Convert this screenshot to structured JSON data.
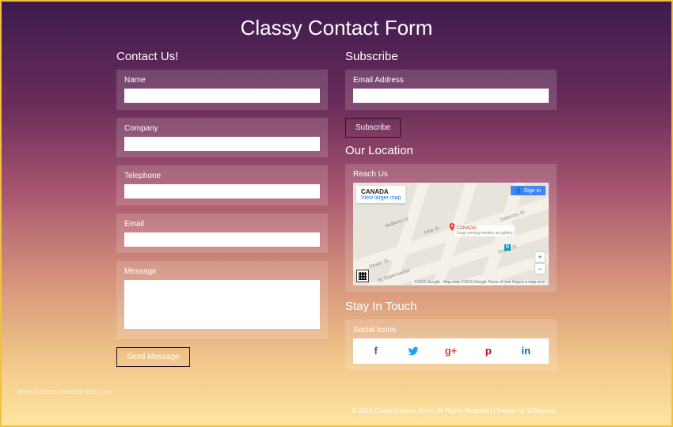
{
  "title": "Classy Contact Form",
  "contact": {
    "heading": "Contact Us!",
    "fields": {
      "name": "Name",
      "company": "Company",
      "telephone": "Telephone",
      "email": "Email",
      "message": "Message"
    },
    "submit": "Send Message"
  },
  "subscribe": {
    "heading": "Subscribe",
    "email_label": "Email Address",
    "button": "Subscribe"
  },
  "location": {
    "heading": "Our Location",
    "label": "Reach Us",
    "map": {
      "country": "CANADA",
      "view_larger": "View larger map",
      "signin": "Sign in",
      "marker_title": "CANADA",
      "marker_sub": "Long-running modern art gallery",
      "streets": [
        "Mulberry St",
        "Mott St",
        "Delancey St",
        "Grand St",
        "Hester St"
      ],
      "supermarket": "ng Supermarket",
      "metro": "M",
      "attribution": "©2016 Google - Map data ©2016 Google   Terms of Use   Report a map error"
    }
  },
  "stay": {
    "heading": "Stay In Touch",
    "label": "Social Icons",
    "icons": {
      "facebook": "f",
      "twitter": "twitter",
      "googleplus": "g+",
      "pinterest": "p",
      "linkedin": "in"
    }
  },
  "footer": "© 2016 Classy Contact Form. All Rights Reserved | Design by W3layouts",
  "watermark": "www.freetemplatesonline.com"
}
